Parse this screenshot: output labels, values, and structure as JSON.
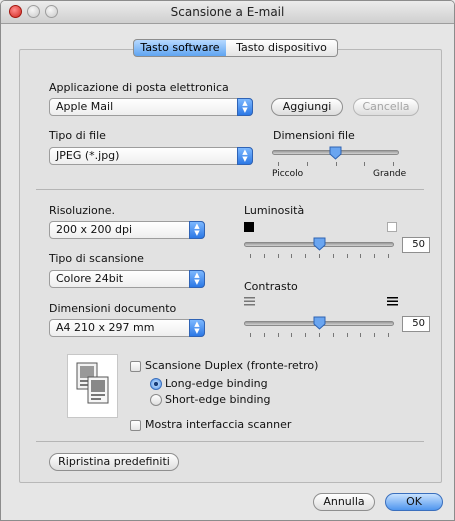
{
  "window": {
    "title": "Scansione a E-mail"
  },
  "tabs": [
    {
      "label": "Tasto software",
      "selected": true
    },
    {
      "label": "Tasto dispositivo",
      "selected": false
    }
  ],
  "email": {
    "label": "Applicazione di posta elettronica",
    "app_value": "Apple Mail",
    "add_label": "Aggiungi",
    "delete_label": "Cancella"
  },
  "file": {
    "type_label": "Tipo di file",
    "type_value": "JPEG (*.jpg)",
    "size_label": "Dimensioni file",
    "size_min_label": "Piccolo",
    "size_max_label": "Grande",
    "size_level": 0.5
  },
  "scan": {
    "resolution_label": "Risoluzione.",
    "resolution_value": "200 x 200 dpi",
    "scan_type_label": "Tipo di scansione",
    "scan_type_value": "Colore 24bit",
    "doc_size_label": "Dimensioni documento",
    "doc_size_value": "A4  210 x 297 mm",
    "brightness_label": "Luminosità",
    "brightness_value": "50",
    "contrast_label": "Contrasto",
    "contrast_value": "50"
  },
  "duplex": {
    "checkbox_label": "Scansione Duplex (fronte-retro)",
    "long_edge_label": "Long-edge binding",
    "short_edge_label": "Short-edge binding",
    "long_edge_selected": true
  },
  "scanner": {
    "show_interface_label": "Mostra interfaccia scanner"
  },
  "buttons": {
    "restore_label": "Ripristina predefiniti",
    "cancel_label": "Annulla",
    "ok_label": "OK"
  },
  "colors": {
    "accent": "#4f96ee",
    "close": "#d0261e"
  }
}
